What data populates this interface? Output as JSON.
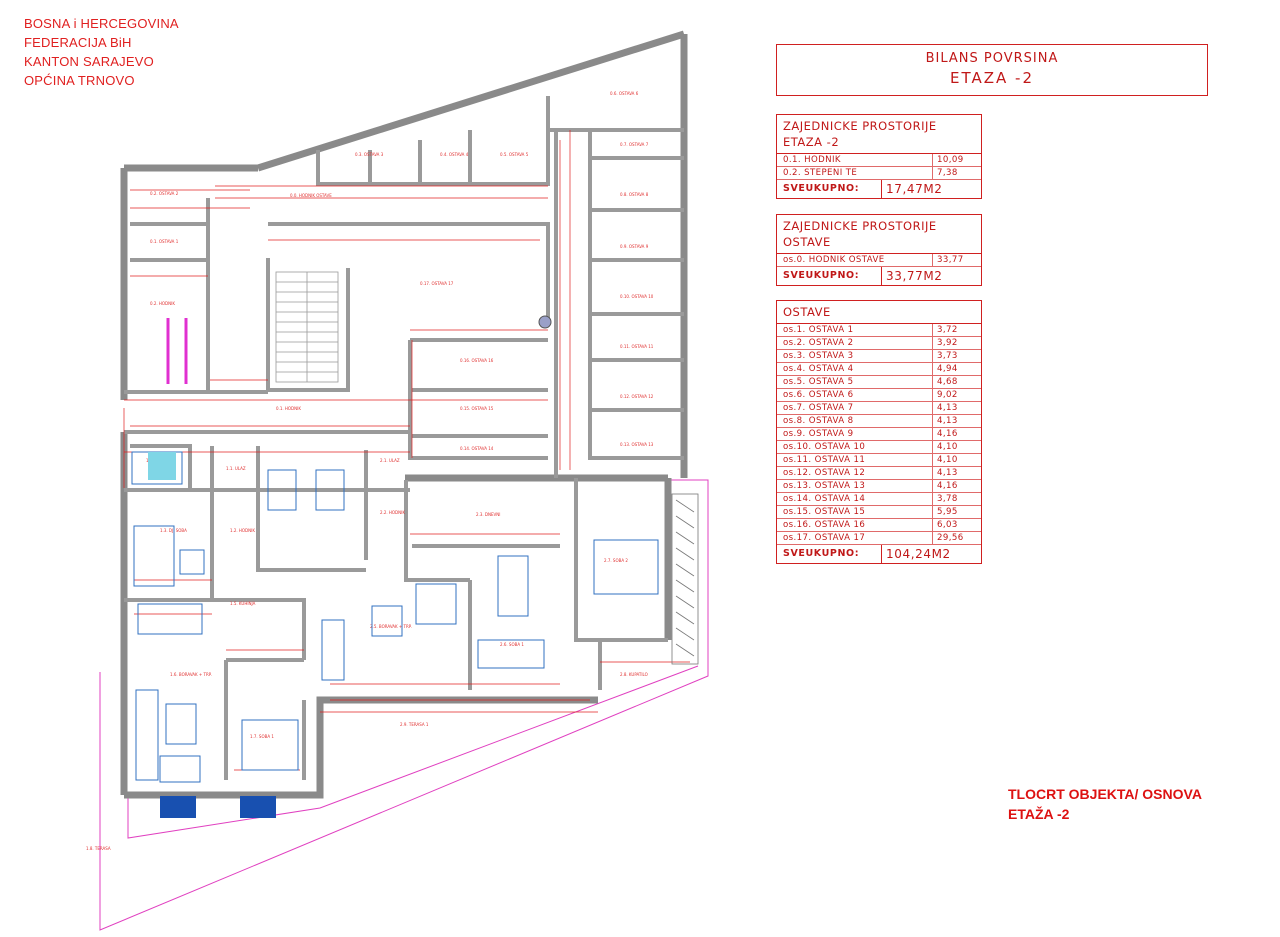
{
  "header": {
    "lines": [
      "BOSNA i HERCEGOVINA",
      "FEDERACIJA BiH",
      "KANTON SARAJEVO",
      "OPĆINA TRNOVO"
    ]
  },
  "title_block": {
    "line1": "BILANS POVRSINA",
    "line2": "ETAZA -2"
  },
  "common_areas": {
    "heading_line1": "ZAJEDNICKE PROSTORIJE",
    "heading_line2": "ETAZA -2",
    "rows": [
      {
        "name": "0.1. HODNIK",
        "value": "10,09"
      },
      {
        "name": "0.2. STEPENI   TE",
        "value": "7,38"
      }
    ],
    "total_label": "SVEUKUPNO:",
    "total_value": "17,47M2"
  },
  "storage_common": {
    "heading_line1": "ZAJEDNICKE PROSTORIJE",
    "heading_line2": "OSTAVE",
    "rows": [
      {
        "name": "os.0. HODNIK OSTAVE",
        "value": "33,77"
      }
    ],
    "total_label": "SVEUKUPNO:",
    "total_value": "33,77M2"
  },
  "storages": {
    "heading": "OSTAVE",
    "rows": [
      {
        "name": "os.1. OSTAVA 1",
        "value": "3,72"
      },
      {
        "name": "os.2. OSTAVA 2",
        "value": "3,92"
      },
      {
        "name": "os.3. OSTAVA 3",
        "value": "3,73"
      },
      {
        "name": "os.4. OSTAVA 4",
        "value": "4,94"
      },
      {
        "name": "os.5. OSTAVA 5",
        "value": "4,68"
      },
      {
        "name": "os.6. OSTAVA 6",
        "value": "9,02"
      },
      {
        "name": "os.7. OSTAVA 7",
        "value": "4,13"
      },
      {
        "name": "os.8. OSTAVA 8",
        "value": "4,13"
      },
      {
        "name": "os.9. OSTAVA 9",
        "value": "4,16"
      },
      {
        "name": "os.10. OSTAVA 10",
        "value": "4,10"
      },
      {
        "name": "os.11. OSTAVA 11",
        "value": "4,10"
      },
      {
        "name": "os.12. OSTAVA 12",
        "value": "4,13"
      },
      {
        "name": "os.13. OSTAVA 13",
        "value": "4,16"
      },
      {
        "name": "os.14. OSTAVA 14",
        "value": "3,78"
      },
      {
        "name": "os.15. OSTAVA 15",
        "value": "5,95"
      },
      {
        "name": "os.16. OSTAVA 16",
        "value": "6,03"
      },
      {
        "name": "os.17. OSTAVA 17",
        "value": "29,56"
      }
    ],
    "total_label": "SVEUKUPNO:",
    "total_value": "104,24M2"
  },
  "drawing_title": {
    "line1": "TLOCRT OBJEKTA/ OSNOVA",
    "line2": "ETAŽA -2"
  },
  "colors": {
    "wall": "#8a8a8a",
    "annotation": "#d01010",
    "terrace": "#e040c0",
    "fixture": "#2060c0"
  }
}
